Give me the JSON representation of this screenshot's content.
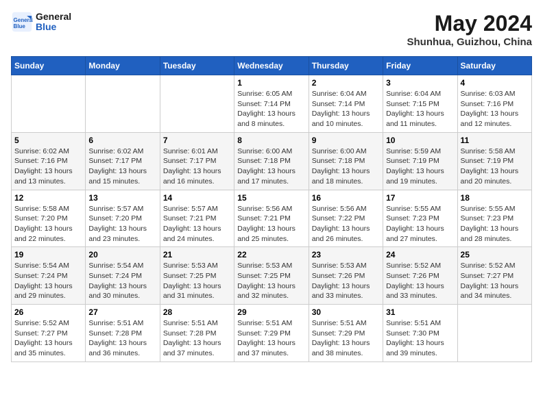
{
  "header": {
    "logo_line1": "General",
    "logo_line2": "Blue",
    "month": "May 2024",
    "location": "Shunhua, Guizhou, China"
  },
  "weekdays": [
    "Sunday",
    "Monday",
    "Tuesday",
    "Wednesday",
    "Thursday",
    "Friday",
    "Saturday"
  ],
  "weeks": [
    [
      {
        "day": "",
        "info": ""
      },
      {
        "day": "",
        "info": ""
      },
      {
        "day": "",
        "info": ""
      },
      {
        "day": "1",
        "info": "Sunrise: 6:05 AM\nSunset: 7:14 PM\nDaylight: 13 hours\nand 8 minutes."
      },
      {
        "day": "2",
        "info": "Sunrise: 6:04 AM\nSunset: 7:14 PM\nDaylight: 13 hours\nand 10 minutes."
      },
      {
        "day": "3",
        "info": "Sunrise: 6:04 AM\nSunset: 7:15 PM\nDaylight: 13 hours\nand 11 minutes."
      },
      {
        "day": "4",
        "info": "Sunrise: 6:03 AM\nSunset: 7:16 PM\nDaylight: 13 hours\nand 12 minutes."
      }
    ],
    [
      {
        "day": "5",
        "info": "Sunrise: 6:02 AM\nSunset: 7:16 PM\nDaylight: 13 hours\nand 13 minutes."
      },
      {
        "day": "6",
        "info": "Sunrise: 6:02 AM\nSunset: 7:17 PM\nDaylight: 13 hours\nand 15 minutes."
      },
      {
        "day": "7",
        "info": "Sunrise: 6:01 AM\nSunset: 7:17 PM\nDaylight: 13 hours\nand 16 minutes."
      },
      {
        "day": "8",
        "info": "Sunrise: 6:00 AM\nSunset: 7:18 PM\nDaylight: 13 hours\nand 17 minutes."
      },
      {
        "day": "9",
        "info": "Sunrise: 6:00 AM\nSunset: 7:18 PM\nDaylight: 13 hours\nand 18 minutes."
      },
      {
        "day": "10",
        "info": "Sunrise: 5:59 AM\nSunset: 7:19 PM\nDaylight: 13 hours\nand 19 minutes."
      },
      {
        "day": "11",
        "info": "Sunrise: 5:58 AM\nSunset: 7:19 PM\nDaylight: 13 hours\nand 20 minutes."
      }
    ],
    [
      {
        "day": "12",
        "info": "Sunrise: 5:58 AM\nSunset: 7:20 PM\nDaylight: 13 hours\nand 22 minutes."
      },
      {
        "day": "13",
        "info": "Sunrise: 5:57 AM\nSunset: 7:20 PM\nDaylight: 13 hours\nand 23 minutes."
      },
      {
        "day": "14",
        "info": "Sunrise: 5:57 AM\nSunset: 7:21 PM\nDaylight: 13 hours\nand 24 minutes."
      },
      {
        "day": "15",
        "info": "Sunrise: 5:56 AM\nSunset: 7:21 PM\nDaylight: 13 hours\nand 25 minutes."
      },
      {
        "day": "16",
        "info": "Sunrise: 5:56 AM\nSunset: 7:22 PM\nDaylight: 13 hours\nand 26 minutes."
      },
      {
        "day": "17",
        "info": "Sunrise: 5:55 AM\nSunset: 7:23 PM\nDaylight: 13 hours\nand 27 minutes."
      },
      {
        "day": "18",
        "info": "Sunrise: 5:55 AM\nSunset: 7:23 PM\nDaylight: 13 hours\nand 28 minutes."
      }
    ],
    [
      {
        "day": "19",
        "info": "Sunrise: 5:54 AM\nSunset: 7:24 PM\nDaylight: 13 hours\nand 29 minutes."
      },
      {
        "day": "20",
        "info": "Sunrise: 5:54 AM\nSunset: 7:24 PM\nDaylight: 13 hours\nand 30 minutes."
      },
      {
        "day": "21",
        "info": "Sunrise: 5:53 AM\nSunset: 7:25 PM\nDaylight: 13 hours\nand 31 minutes."
      },
      {
        "day": "22",
        "info": "Sunrise: 5:53 AM\nSunset: 7:25 PM\nDaylight: 13 hours\nand 32 minutes."
      },
      {
        "day": "23",
        "info": "Sunrise: 5:53 AM\nSunset: 7:26 PM\nDaylight: 13 hours\nand 33 minutes."
      },
      {
        "day": "24",
        "info": "Sunrise: 5:52 AM\nSunset: 7:26 PM\nDaylight: 13 hours\nand 33 minutes."
      },
      {
        "day": "25",
        "info": "Sunrise: 5:52 AM\nSunset: 7:27 PM\nDaylight: 13 hours\nand 34 minutes."
      }
    ],
    [
      {
        "day": "26",
        "info": "Sunrise: 5:52 AM\nSunset: 7:27 PM\nDaylight: 13 hours\nand 35 minutes."
      },
      {
        "day": "27",
        "info": "Sunrise: 5:51 AM\nSunset: 7:28 PM\nDaylight: 13 hours\nand 36 minutes."
      },
      {
        "day": "28",
        "info": "Sunrise: 5:51 AM\nSunset: 7:28 PM\nDaylight: 13 hours\nand 37 minutes."
      },
      {
        "day": "29",
        "info": "Sunrise: 5:51 AM\nSunset: 7:29 PM\nDaylight: 13 hours\nand 37 minutes."
      },
      {
        "day": "30",
        "info": "Sunrise: 5:51 AM\nSunset: 7:29 PM\nDaylight: 13 hours\nand 38 minutes."
      },
      {
        "day": "31",
        "info": "Sunrise: 5:51 AM\nSunset: 7:30 PM\nDaylight: 13 hours\nand 39 minutes."
      },
      {
        "day": "",
        "info": ""
      }
    ]
  ]
}
